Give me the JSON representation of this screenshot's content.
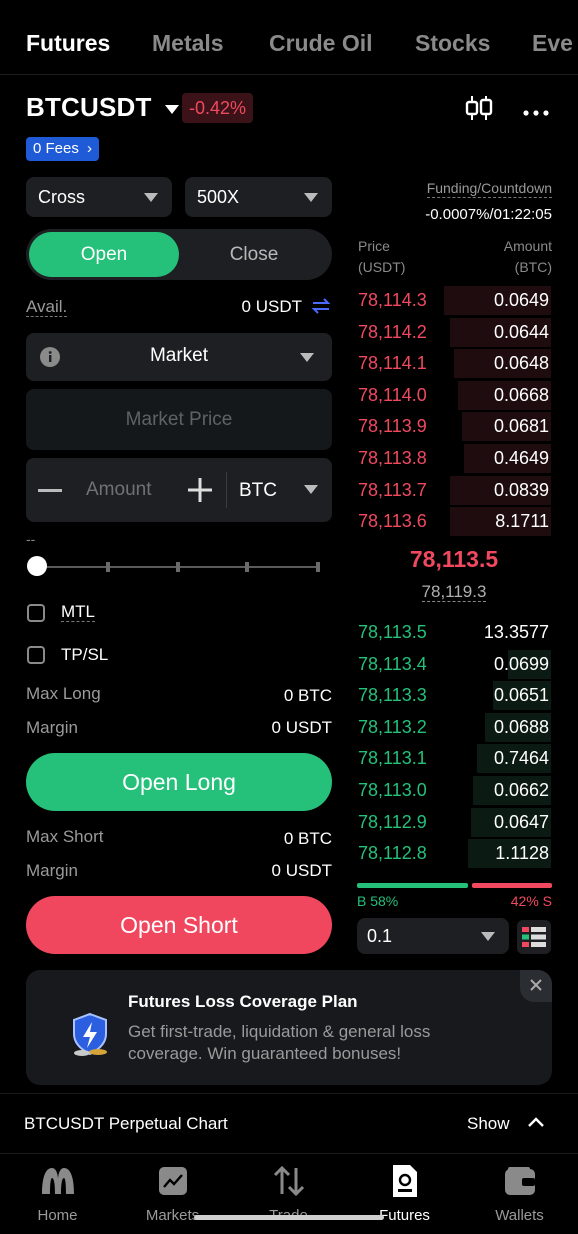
{
  "tabs": [
    "Futures",
    "Metals",
    "Crude Oil",
    "Stocks",
    "Eve"
  ],
  "header": {
    "pair": "BTCUSDT",
    "change": "-0.42%",
    "fees_badge": "0 Fees",
    "fees_chevron": "›"
  },
  "form": {
    "margin_mode": "Cross",
    "leverage": "500X",
    "open_label": "Open",
    "close_label": "Close",
    "avail_label": "Avail.",
    "avail_value": "0 USDT",
    "order_type": "Market",
    "price_placeholder": "Market Price",
    "amount_placeholder": "Amount",
    "amount_unit": "BTC",
    "slider_value_text": "--",
    "slider_fraction": 0,
    "mtl_label": "MTL",
    "tpsl_label": "TP/SL",
    "max_long_label": "Max Long",
    "max_long_value": "0 BTC",
    "margin_long_label": "Margin",
    "margin_long_value": "0 USDT",
    "open_long_button": "Open Long",
    "max_short_label": "Max Short",
    "max_short_value": "0 BTC",
    "margin_short_label": "Margin",
    "margin_short_value": "0 USDT",
    "open_short_button": "Open Short"
  },
  "orderbook": {
    "funding_label": "Funding/Countdown",
    "funding_value": "-0.0007%/01:22:05",
    "price_header": "Price",
    "price_unit": "(USDT)",
    "amount_header": "Amount",
    "amount_unit": "(BTC)",
    "asks": [
      {
        "price": "78,114.3",
        "amount": "0.0649",
        "depth": 0.55
      },
      {
        "price": "78,114.2",
        "amount": "0.0644",
        "depth": 0.52
      },
      {
        "price": "78,114.1",
        "amount": "0.0648",
        "depth": 0.5
      },
      {
        "price": "78,114.0",
        "amount": "0.0668",
        "depth": 0.48
      },
      {
        "price": "78,113.9",
        "amount": "0.0681",
        "depth": 0.46
      },
      {
        "price": "78,113.8",
        "amount": "0.4649",
        "depth": 0.45
      },
      {
        "price": "78,113.7",
        "amount": "0.0839",
        "depth": 0.52
      },
      {
        "price": "78,113.6",
        "amount": "8.1711",
        "depth": 0.52
      }
    ],
    "last_price": "78,113.5",
    "mark_price": "78,119.3",
    "bids": [
      {
        "price": "78,113.5",
        "amount": "13.3577",
        "depth": 0.0
      },
      {
        "price": "78,113.4",
        "amount": "0.0699",
        "depth": 0.22
      },
      {
        "price": "78,113.3",
        "amount": "0.0651",
        "depth": 0.3
      },
      {
        "price": "78,113.2",
        "amount": "0.0688",
        "depth": 0.34
      },
      {
        "price": "78,113.1",
        "amount": "0.7464",
        "depth": 0.38
      },
      {
        "price": "78,113.0",
        "amount": "0.0662",
        "depth": 0.4
      },
      {
        "price": "78,112.9",
        "amount": "0.0647",
        "depth": 0.41
      },
      {
        "price": "78,112.8",
        "amount": "1.1128",
        "depth": 0.43
      }
    ],
    "buy_ratio": "B 58%",
    "sell_ratio": "42% S",
    "buy_fraction": 0.58,
    "precision": "0.1"
  },
  "promo": {
    "title": "Futures Loss Coverage Plan",
    "body": "Get first-trade, liquidation & general loss coverage. Win guaranteed bonuses!"
  },
  "chart_bar": {
    "title": "BTCUSDT Perpetual Chart",
    "show_label": "Show"
  },
  "nav": [
    "Home",
    "Markets",
    "Trade",
    "Futures",
    "Wallets"
  ],
  "colors": {
    "green": "#25c07a",
    "red": "#f0495f",
    "fees_blue": "#1f5bd6"
  }
}
